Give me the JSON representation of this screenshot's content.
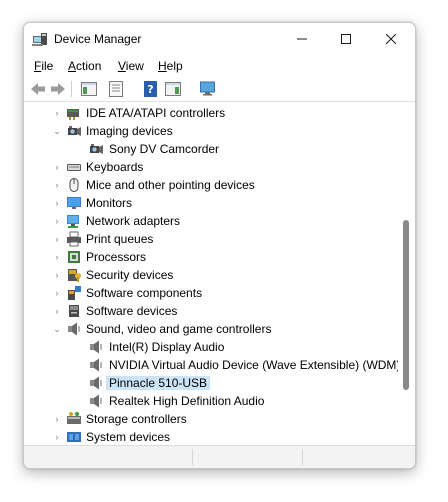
{
  "window": {
    "title": "Device Manager"
  },
  "menu": [
    {
      "label_underlined": "F",
      "label_rest": "ile"
    },
    {
      "label_underlined": "A",
      "label_rest": "ction"
    },
    {
      "label_underlined": "V",
      "label_rest": "iew"
    },
    {
      "label_underlined": "H",
      "label_rest": "elp"
    }
  ],
  "tree": [
    {
      "label": "IDE ATA/ATAPI controllers",
      "icon": "ide-controller-icon",
      "level": 1,
      "expander": "collapsed"
    },
    {
      "label": "Imaging devices",
      "icon": "camera-icon",
      "level": 1,
      "expander": "expanded"
    },
    {
      "label": "Sony DV Camcorder",
      "icon": "camera-icon",
      "level": 2,
      "expander": "none"
    },
    {
      "label": "Keyboards",
      "icon": "keyboard-icon",
      "level": 1,
      "expander": "collapsed"
    },
    {
      "label": "Mice and other pointing devices",
      "icon": "mouse-icon",
      "level": 1,
      "expander": "collapsed"
    },
    {
      "label": "Monitors",
      "icon": "monitor-icon",
      "level": 1,
      "expander": "collapsed"
    },
    {
      "label": "Network adapters",
      "icon": "network-adapter-icon",
      "level": 1,
      "expander": "collapsed"
    },
    {
      "label": "Print queues",
      "icon": "printer-icon",
      "level": 1,
      "expander": "collapsed"
    },
    {
      "label": "Processors",
      "icon": "processor-icon",
      "level": 1,
      "expander": "collapsed"
    },
    {
      "label": "Security devices",
      "icon": "security-device-icon",
      "level": 1,
      "expander": "collapsed"
    },
    {
      "label": "Software components",
      "icon": "software-component-icon",
      "level": 1,
      "expander": "collapsed"
    },
    {
      "label": "Software devices",
      "icon": "software-device-icon",
      "level": 1,
      "expander": "collapsed"
    },
    {
      "label": "Sound, video and game controllers",
      "icon": "speaker-icon",
      "level": 1,
      "expander": "expanded"
    },
    {
      "label": "Intel(R) Display Audio",
      "icon": "speaker-icon",
      "level": 2,
      "expander": "none"
    },
    {
      "label": "NVIDIA Virtual Audio Device (Wave Extensible) (WDM)",
      "icon": "speaker-icon",
      "level": 2,
      "expander": "none"
    },
    {
      "label": "Pinnacle 510-USB",
      "icon": "speaker-icon",
      "level": 2,
      "expander": "none",
      "selected": true
    },
    {
      "label": "Realtek High Definition Audio",
      "icon": "speaker-icon",
      "level": 2,
      "expander": "none"
    },
    {
      "label": "Storage controllers",
      "icon": "storage-controller-icon",
      "level": 1,
      "expander": "collapsed"
    },
    {
      "label": "System devices",
      "icon": "system-device-icon",
      "level": 1,
      "expander": "collapsed"
    }
  ],
  "colors": {
    "selection": "#cce4f7",
    "scroll_thumb": "#8a8a8a"
  }
}
